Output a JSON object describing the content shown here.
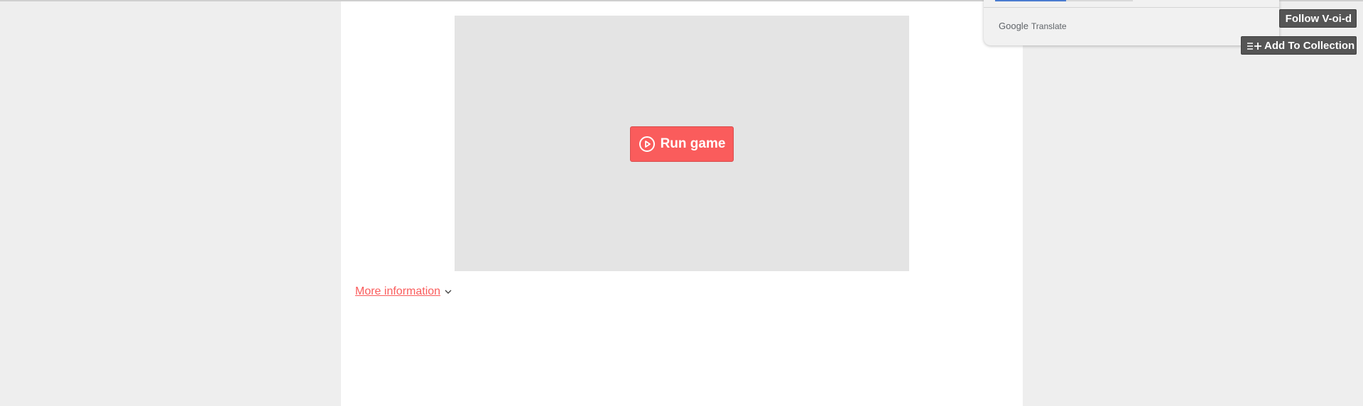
{
  "game": {
    "run_label": "Run game"
  },
  "details": {
    "more_info_label": "More information"
  },
  "translate_popup": {
    "brand_google": "Google",
    "brand_translate": "Translate"
  },
  "actions": {
    "follow_label": "Follow V-oi-d",
    "add_collection_label": "Add To Collection"
  },
  "colors": {
    "accent": "#fa5c5c",
    "dark_button": "#555555",
    "page_bg": "#eeeeee",
    "game_frame": "#e4e4e4"
  },
  "icons": {
    "run": "play-circle-icon",
    "more_info": "chevron-down-icon",
    "collection": "add-to-collection-icon"
  }
}
